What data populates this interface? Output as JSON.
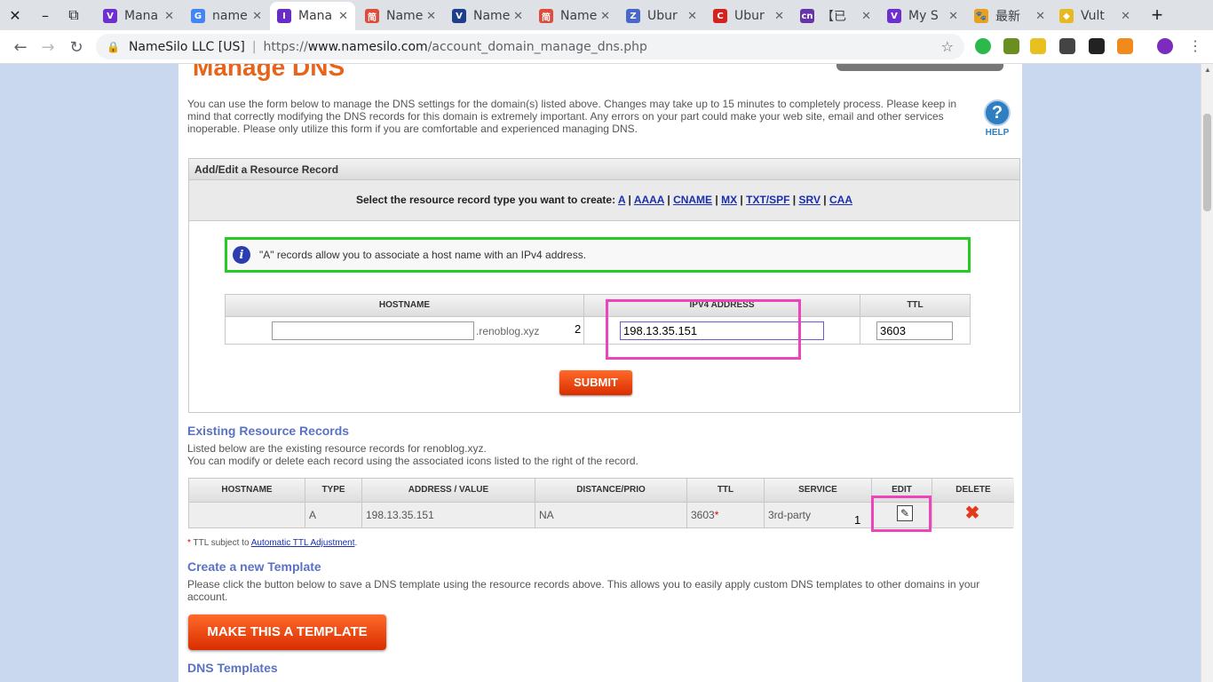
{
  "browser": {
    "window_close": "✕",
    "window_minimize": "–",
    "window_restore": "⧉",
    "tabs": [
      {
        "label": "Mana",
        "favicon": "V",
        "color": "#6f2fd0"
      },
      {
        "label": "name",
        "favicon": "G",
        "color": "#4285f4"
      },
      {
        "label": "Mana",
        "favicon": "I",
        "color": "#6a2cc7"
      },
      {
        "label": "Name",
        "favicon": "简",
        "color": "#e04c3c"
      },
      {
        "label": "Name",
        "favicon": "V",
        "color": "#1e3f8c"
      },
      {
        "label": "Name",
        "favicon": "简",
        "color": "#e04c3c"
      },
      {
        "label": "Ubur",
        "favicon": "Z",
        "color": "#4a68c9"
      },
      {
        "label": "Ubur",
        "favicon": "C",
        "color": "#d4231f"
      },
      {
        "label": "【已",
        "favicon": "cn",
        "color": "#6633aa"
      },
      {
        "label": "My S",
        "favicon": "V",
        "color": "#6f2fd0"
      },
      {
        "label": "最新",
        "favicon": "🐾",
        "color": "#e8a020"
      },
      {
        "label": "Vult",
        "favicon": "◆",
        "color": "#e8b820"
      }
    ],
    "new_tab": "+",
    "back": "←",
    "forward": "→",
    "reload": "↻",
    "site_identity": "NameSilo LLC [US]",
    "url_protocol": "https://",
    "url_host": "www.namesilo.com",
    "url_path": "/account_domain_manage_dns.php",
    "bookmark_star": "☆"
  },
  "page": {
    "title": "Manage DNS",
    "intro": "You can use the form below to manage the DNS settings for the domain(s) listed above. Changes may take up to 15 minutes to completely process. Please keep in mind that correctly modifying the DNS records for this domain is extremely important. Any errors on your part could make your web site, email and other services inoperable. Please only utilize this form if you are comfortable and experienced managing DNS.",
    "help_label": "HELP",
    "help_glyph": "?",
    "add_edit": {
      "header": "Add/Edit a Resource Record",
      "select_prompt": "Select the resource record type you want to create:",
      "record_types": [
        "A",
        "AAAA",
        "CNAME",
        "MX",
        "TXT/SPF",
        "SRV",
        "CAA"
      ],
      "info_text": "\"A\" records allow you to associate a host name with an IPv4 address.",
      "info_glyph": "i",
      "columns": {
        "hostname": "HOSTNAME",
        "ipv4": "IPV4 ADDRESS",
        "ttl": "TTL"
      },
      "hostname_value": "",
      "domain_suffix": ".renoblog.xyz",
      "ipv4_value": "198.13.35.151",
      "ttl_value": "3603",
      "submit_label": "SUBMIT"
    },
    "existing": {
      "title": "Existing Resource Records",
      "desc_line1": "Listed below are the existing resource records for renoblog.xyz.",
      "desc_line2": "You can modify or delete each record using the associated icons listed to the right of the record.",
      "columns": [
        "HOSTNAME",
        "TYPE",
        "ADDRESS / VALUE",
        "DISTANCE/PRIO",
        "TTL",
        "SERVICE",
        "EDIT",
        "DELETE"
      ],
      "rows": [
        {
          "hostname": "",
          "type": "A",
          "address": "198.13.35.151",
          "distance": "NA",
          "ttl": "3603",
          "service": "3rd-party"
        }
      ],
      "edit_glyph": "✎",
      "delete_glyph": "✖"
    },
    "ttl_note_star": "*",
    "ttl_note_prefix": "TTL subject to",
    "ttl_note_link": "Automatic TTL Adjustment",
    "template": {
      "title": "Create a new Template",
      "desc": "Please click the button below to save a DNS template using the resource records above. This allows you to easily apply custom DNS templates to other domains in your account.",
      "button_label": "MAKE THIS A TEMPLATE"
    },
    "dns_templates_title": "DNS Templates"
  },
  "annotations": {
    "edit_step": "1",
    "ipv4_step": "2"
  },
  "colors": {
    "accent": "#e8641b",
    "link": "#1a2fb0",
    "section_title": "#5a72c2",
    "annotation": "#ee44bb",
    "info_border": "#22cc22"
  }
}
